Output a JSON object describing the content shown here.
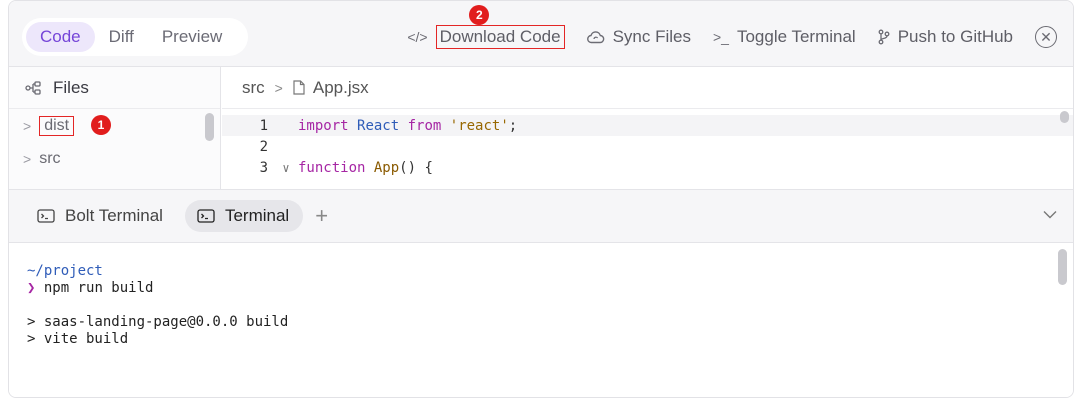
{
  "view_toggle": {
    "tabs": [
      "Code",
      "Diff",
      "Preview"
    ],
    "active": "Code"
  },
  "toolbar": {
    "download_code": "Download Code",
    "sync_files": "Sync Files",
    "toggle_terminal": "Toggle Terminal",
    "push_to_github": "Push to GitHub"
  },
  "markers": {
    "first": "1",
    "second": "2"
  },
  "files_panel": {
    "title": "Files",
    "items": [
      {
        "label": "dist"
      },
      {
        "label": "src"
      }
    ]
  },
  "editor": {
    "breadcrumb": {
      "folder": "src",
      "file": "App.jsx"
    },
    "lines": [
      {
        "num": "1",
        "t1": "import",
        "t2": " ",
        "t3": "React",
        "t4": " ",
        "t5": "from",
        "t6": " ",
        "t7": "'react'",
        "t8": ";"
      },
      {
        "num": "2"
      },
      {
        "num": "3",
        "t1": "function",
        "t2": " ",
        "t3": "App",
        "t4": "() {"
      }
    ]
  },
  "terminal": {
    "tabs": [
      {
        "label": "Bolt Terminal"
      },
      {
        "label": "Terminal"
      }
    ],
    "active_tab": "Terminal",
    "lines": {
      "path": "~/project",
      "prompt_symbol": "❯",
      "command": " npm run build",
      "out1": "> saas-landing-page@0.0.0 build",
      "out2": "> vite build"
    }
  },
  "colors": {
    "accent": "#7545d8",
    "highlight_box": "#e32626",
    "marker": "#e11d1d"
  }
}
